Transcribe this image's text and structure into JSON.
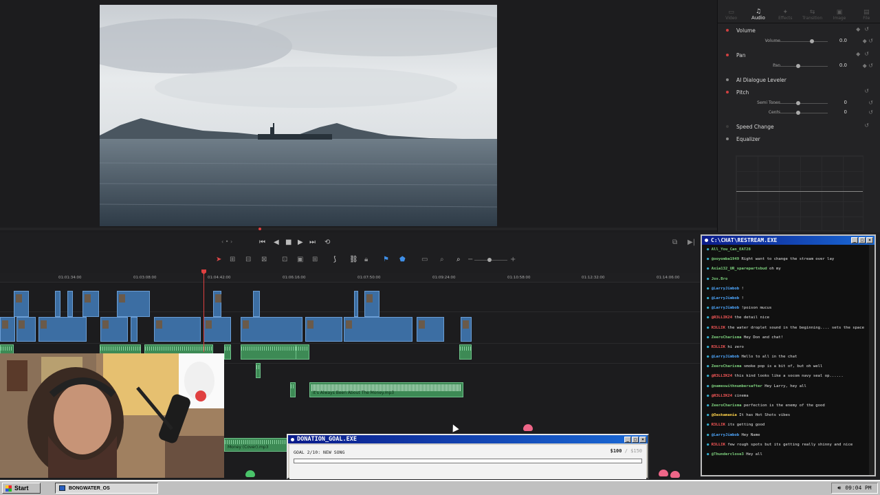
{
  "inspector": {
    "tabs": [
      {
        "label": "Video",
        "icon": "▭"
      },
      {
        "label": "Audio",
        "icon": "♫"
      },
      {
        "label": "Effects",
        "icon": "✦"
      },
      {
        "label": "Transition",
        "icon": "⇆"
      },
      {
        "label": "Image",
        "icon": "▣"
      },
      {
        "label": "File",
        "icon": "▤"
      }
    ],
    "active_tab": "Audio",
    "volume": {
      "title": "Volume",
      "label": "Volume",
      "value": "0.0"
    },
    "pan": {
      "title": "Pan",
      "label": "Pan",
      "value": "0.0"
    },
    "dialogue": {
      "title": "AI Dialogue Leveler"
    },
    "pitch": {
      "title": "Pitch",
      "semitones_label": "Semi Tones",
      "semitones_value": "0",
      "cents_label": "Cents",
      "cents_value": "0"
    },
    "speed": {
      "title": "Speed Change"
    },
    "equalizer": {
      "title": "Equalizer"
    }
  },
  "ruler": [
    "01:01:34:00",
    "01:03:08:00",
    "01:04:42:00",
    "01:06:16:00",
    "01:07:50:00",
    "01:09:24:00",
    "01:10:58:00",
    "01:12:32:00",
    "01:14:06:00"
  ],
  "timeline": {
    "music_clip": "It's Always Been About The Money.mp3",
    "money_clip": "Money (Cover).mp3"
  },
  "chat": {
    "title": "C:\\CHAT\\RESTREAM.EXE",
    "messages": [
      {
        "user": "All_You_Can_EAT28",
        "text": "",
        "color": "#7fd37f"
      },
      {
        "user": "@ooyomba1949",
        "text": "Right want to change the stream over lay",
        "color": "#7fd37f"
      },
      {
        "user": "Axia132_UR_sparepartsbud",
        "text": "oh my",
        "color": "#7fd37f"
      },
      {
        "user": "Jos.Bro",
        "text": "",
        "color": "#7fd37f"
      },
      {
        "user": "@LarryJimbob",
        "text": "!",
        "color": "#4fa8ff"
      },
      {
        "user": "@LarryJimbob",
        "text": "!",
        "color": "#4fa8ff"
      },
      {
        "user": "@LarryJimbob",
        "text": "!poison mucus",
        "color": "#4fa8ff"
      },
      {
        "user": "@R3LLIK24",
        "text": "the detail nice",
        "color": "#ff5a5a"
      },
      {
        "user": "R3LLIK",
        "text": "the water droplet sound in the beginning.... sets the space",
        "color": "#ff5a5a"
      },
      {
        "user": "ZeeroCharisma",
        "text": "Hey Don and chat!",
        "color": "#7fd37f"
      },
      {
        "user": "R3LLIK",
        "text": "hi zero",
        "color": "#ff5a5a"
      },
      {
        "user": "@LarryJimbob",
        "text": "Hello to all in the chat",
        "color": "#4fa8ff"
      },
      {
        "user": "ZeeroCharisma",
        "text": "smoke pop is a bit of, but oh well",
        "color": "#7fd37f"
      },
      {
        "user": "@R3LLIK24",
        "text": "this kind looks like a socom navy seal op......",
        "color": "#ff5a5a"
      },
      {
        "user": "@nameswithnumbersafter",
        "text": "Hey Larry, hey all",
        "color": "#7fd37f"
      },
      {
        "user": "@R3LLIK24",
        "text": "cinema",
        "color": "#ff5a5a"
      },
      {
        "user": "ZeeroCharisma",
        "text": "perfection is the enemy of the good",
        "color": "#7fd37f"
      },
      {
        "user": "@Oaskamania",
        "text": "It has Hot Shots vibes",
        "color": "#ffd24a"
      },
      {
        "user": "R3LLIK",
        "text": "its getting good",
        "color": "#ff5a5a"
      },
      {
        "user": "@LarryJimbob",
        "text": "Hey Name",
        "color": "#4fa8ff"
      },
      {
        "user": "R3LLIK",
        "text": "few rough spots but its getting really shinny and nice",
        "color": "#ff5a5a"
      },
      {
        "user": "@Thunderclose3",
        "text": "Hey all",
        "color": "#7fd37f"
      }
    ]
  },
  "donation": {
    "title": "DONATION_GOAL.EXE",
    "goal": "GOAL 2/10: NEW SONG",
    "current": "$100",
    "sep": "/",
    "target": "$150",
    "progress": 0.0
  },
  "taskbar": {
    "start": "Start",
    "task": "BONGWATER_OS",
    "time": "09:04 PM"
  },
  "colors": {
    "video_clip": "#3c6ea3",
    "audio_clip": "#3d8a55",
    "playhead": "#e04040",
    "title_bar": "#0b1b8a"
  }
}
